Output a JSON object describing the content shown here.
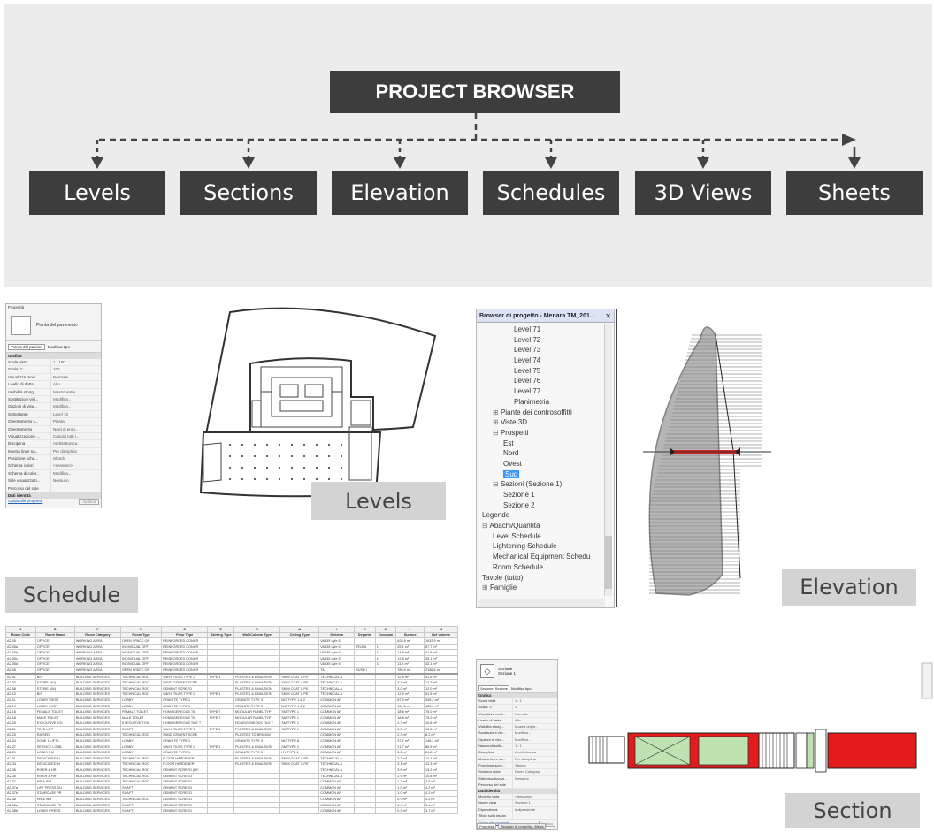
{
  "diagram": {
    "title": "PROJECT BROWSER",
    "categories": [
      "Levels",
      "Sections",
      "Elevation",
      "Schedules",
      "3D Views",
      "Sheets"
    ]
  },
  "labels": {
    "levels": "Levels",
    "elevation": "Elevation",
    "schedule": "Schedule",
    "section": "Section"
  },
  "properties_panel": {
    "header": "Proprietà",
    "type_name": "Pianta del pavimento",
    "type_selector": "Pianta del pavime",
    "edit_type": "Modifica tipo",
    "group": "Grafica",
    "rows": [
      {
        "k": "Scala vista",
        "v": "1 : 100"
      },
      {
        "k": "Scala: 1:",
        "v": "100"
      },
      {
        "k": "Visualizza modi...",
        "v": "Normale"
      },
      {
        "k": "Livello di detta...",
        "v": "Alto"
      },
      {
        "k": "Visibilità strutg...",
        "v": "Mostra entra..."
      },
      {
        "k": "Sostituzioni visi...",
        "v": "Modifica..."
      },
      {
        "k": "Opzioni di visu...",
        "v": "Modifica..."
      },
      {
        "k": "Sottostante",
        "v": "Level 10"
      },
      {
        "k": "Orientamento s...",
        "v": "Pianta"
      },
      {
        "k": "Orientamento",
        "v": "Nord di prog..."
      },
      {
        "k": "Visualizzazione ...",
        "v": "Calcola tutti i..."
      },
      {
        "k": "Disciplina",
        "v": "Architettonica"
      },
      {
        "k": "Mostra linee na...",
        "v": "Per disciplina"
      },
      {
        "k": "Posizione sche...",
        "v": "Sfondo"
      },
      {
        "k": "Schema colori",
        "v": "<nessuno>"
      },
      {
        "k": "Schema di color...",
        "v": "Modifica..."
      },
      {
        "k": "Stile visualizzazi...",
        "v": "Nessuno"
      },
      {
        "k": "Percorso del sole",
        "v": ""
      }
    ],
    "group2": "Dati identità",
    "help_link": "Guida alle proprietà",
    "apply": "Applica"
  },
  "browser_panel": {
    "title": "Browser di progetto - Menara TM_201...",
    "close": "✕",
    "items": [
      {
        "label": "Level 71",
        "indent": 3
      },
      {
        "label": "Level 72",
        "indent": 3
      },
      {
        "label": "Level 73",
        "indent": 3
      },
      {
        "label": "Level 74",
        "indent": 3
      },
      {
        "label": "Level 75",
        "indent": 3
      },
      {
        "label": "Level 76",
        "indent": 3
      },
      {
        "label": "Level 77",
        "indent": 3
      },
      {
        "label": "Planimetria",
        "indent": 3
      },
      {
        "label": "Piante dei controsoffitti",
        "indent": 1,
        "toggle": "+"
      },
      {
        "label": "Viste 3D",
        "indent": 1,
        "toggle": "+"
      },
      {
        "label": "Prospetti",
        "indent": 1,
        "toggle": "−"
      },
      {
        "label": "Est",
        "indent": 2
      },
      {
        "label": "Nord",
        "indent": 2
      },
      {
        "label": "Ovest",
        "indent": 2
      },
      {
        "label": "Sud",
        "indent": 2,
        "selected": true
      },
      {
        "label": "Sezioni (Sezione 1)",
        "indent": 1,
        "toggle": "−"
      },
      {
        "label": "Sezione 1",
        "indent": 2
      },
      {
        "label": "Sezione 2",
        "indent": 2
      },
      {
        "label": "Legende",
        "indent": 0
      },
      {
        "label": "Abachi/Quantità",
        "indent": 0,
        "toggle": "−"
      },
      {
        "label": "Level Schedule",
        "indent": 1
      },
      {
        "label": "Lightening Schedule",
        "indent": 1
      },
      {
        "label": "Mechanical Equipment Schedu",
        "indent": 1
      },
      {
        "label": "Room Schedule",
        "indent": 1
      },
      {
        "label": "Tavole (tutto)",
        "indent": 0
      },
      {
        "label": "Famiglie",
        "indent": 0,
        "toggle": "+"
      }
    ]
  },
  "schedule": {
    "letters": [
      "A",
      "B",
      "C",
      "D",
      "E",
      "F",
      "G",
      "H",
      "I",
      "J",
      "K",
      "L",
      "M"
    ],
    "headers": [
      "Room Code",
      "Room Name",
      "Room Category",
      "Room Type",
      "Floor Type",
      "Skirting Type",
      "Wall/Column Type",
      "Ceiling Type",
      "Division",
      "Departm",
      "Occupan",
      "Surface",
      "Net Volume"
    ],
    "rows": [
      [
        "A2.05",
        "OFFICE",
        "WORKING AREA",
        "OPEN SPACE OF",
        "REINFORCED CONCR",
        "",
        "",
        "",
        "VA535 Lyfe 5",
        "",
        "",
        "628.8 m²",
        "1933.5 m³"
      ],
      [
        "A2.05a",
        "OFFICE",
        "WORKING AREA",
        "INDIVIDUAL OFFI",
        "REINFORCED CONCR",
        "",
        "",
        "",
        "VA535 Lyfe 5",
        "TELEA",
        "1",
        "25.1 m²",
        "87.7 m³"
      ],
      [
        "A2.05b",
        "OFFICE",
        "WORKING AREA",
        "INDIVIDUAL OFFI",
        "REINFORCED CONCR",
        "",
        "",
        "",
        "VA535 Lyfe 5",
        "",
        "1",
        "14.8 m²",
        "41.8 m³"
      ],
      [
        "A2.05c",
        "OFFICE",
        "WORKING AREA",
        "INDIVIDUAL OFFI",
        "REINFORCED CONCR",
        "",
        "",
        "",
        "VA535 Lyfe 5",
        "",
        "1",
        "12.6 m²",
        "35.1 m³"
      ],
      [
        "A2.05d",
        "OFFICE",
        "WORKING AREA",
        "INDIVIDUAL OFFI",
        "REINFORCED CONCR",
        "",
        "",
        "",
        "VA535 Lyfe 5",
        "",
        "1",
        "11.2 m²",
        "32.1 m³"
      ],
      [
        "A2.06",
        "OFFICE",
        "WORKING AREA",
        "OPEN SPACE OF",
        "REINFORCED CONCR",
        "",
        "",
        "",
        "TA",
        "SUSD I",
        "",
        "786.6 m²",
        "2186.6 m³"
      ],
      [
        "A2.01",
        "BIS",
        "BUILDING SERVICES",
        "TECHNICAL ROO",
        "VINYL TILES TYPE 2",
        "TYPE 1",
        "PLASTER & EMULSION",
        "SKIM COAT & PE",
        "TECHNICAL A",
        "",
        "",
        "12.8 m²",
        "51.6 m³"
      ],
      [
        "A2.03",
        "STORE (AV)",
        "BUILDING SERVICES",
        "TECHNICAL ROO",
        "SAND CEMENT SCRE",
        "",
        "PLASTER & EMULSION",
        "SKIM COAT & PE",
        "TECHNICAL A",
        "",
        "",
        "3.1 m²",
        "12.3 m³"
      ],
      [
        "A2.08",
        "STORE (AV)",
        "BUILDING SERVICES",
        "TECHNICAL ROO",
        "CEMENT SCREED",
        "",
        "PLASTER & EMULSION",
        "SKIM COAT & PE",
        "TECHNICAL A",
        "",
        "",
        "3.0 m²",
        "12.0 m³"
      ],
      [
        "A2.10",
        "BIS",
        "BUILDING SERVICES",
        "TECHNICAL ROO",
        "VINYL TILES TYPE 2",
        "TYPE 1",
        "PLASTER & EMULSION",
        "SKIM COAT & PE",
        "TECHNICAL A",
        "",
        "",
        "12.9 m²",
        "51.5 m³"
      ],
      [
        "A2.11",
        "LOBBY WEST",
        "BUILDING SERVICES",
        "LOBBY",
        "GRANITE TYPE 1",
        "",
        "GRANITE TYPE 3",
        "MC TYPE 1 & 2",
        "COMMON AR",
        "",
        "",
        "87.3 m²",
        "349.2 m³"
      ],
      [
        "A2.14",
        "LOBBY EAST",
        "BUILDING SERVICES",
        "LOBBY",
        "GRANITE TYPE 1",
        "",
        "GRANITE TYPE 3",
        "MC TYPE 1 & 2",
        "COMMON AR",
        "",
        "",
        "161.5 m²",
        "485.9 m³"
      ],
      [
        "A2.16",
        "FEMALE TOILET",
        "BUILDING SERVICES",
        "FEMALE TOILET",
        "HOMOGENEOUS TIL",
        "TYPE 7",
        "MODULAR PANEL TYP",
        "SM TYPE 1",
        "COMMON AR",
        "",
        "",
        "18.8 m²",
        "75.0 m³"
      ],
      [
        "A2.18",
        "MALE TOILET",
        "BUILDING SERVICES",
        "MALE TOILET",
        "HOMOGENEOUS TIL",
        "TYPE 7",
        "MODULAR PANEL TYP",
        "SM TYPE 1",
        "COMMON AR",
        "",
        "",
        "18.8 m²",
        "75.0 m³"
      ],
      [
        "A2.20",
        "EXECUTIVE TOI",
        "BUILDING SERVICES",
        "EXECUTIVE TOIL",
        "HOMOGENEOUS TILE T",
        "",
        "HOMOGENEOUS TILE T",
        "SM TYPE 1",
        "COMMON AR",
        "",
        "",
        "2.7 m²",
        "10.8 m³"
      ],
      [
        "A2.21",
        "TELE LIFT",
        "BUILDING SERVICES",
        "SHAFT",
        "VINYL TILES TYPE 1",
        "TYPE 1",
        "PLASTER & EMULSION",
        "SM TYPE 1",
        "COMMON AR",
        "",
        "",
        "3.3 m²",
        "13.8 m³"
      ],
      [
        "A2.23",
        "RAISED",
        "BUILDING SERVICES",
        "TECHNICAL ROO",
        "SAND CEMENT SCRE",
        "",
        "PLASTER TO BRICKW",
        "",
        "COMMON AR",
        "",
        "",
        "2.3 m²",
        "8.2 m³"
      ],
      [
        "A2.24",
        "ZONE 1 LIFT L",
        "BUILDING SERVICES",
        "LOBBY",
        "GRANITE TYPE 1",
        "",
        "GRANITE TYPE 3",
        "MC TYPE 8",
        "COMMON AR",
        "",
        "",
        "37.1 m²",
        "148.4 m³"
      ],
      [
        "A2.27",
        "SERVICE LOBB",
        "BUILDING SERVICES",
        "LOBBY",
        "VINYL TILES TYPE 2",
        "TYPE 1",
        "PLASTER & EMULSION",
        "SM TYPE 2",
        "COMMON AR",
        "",
        "",
        "21.7 m²",
        "86.9 m³"
      ],
      [
        "A2.29",
        "LOBBY FM",
        "BUILDING SERVICES",
        "LOBBY",
        "GRANITE TYPE 1",
        "",
        "GRANITE TYPE 3",
        "HY TYPE 1",
        "COMMON AR",
        "",
        "",
        "6.2 m²",
        "24.8 m³"
      ],
      [
        "A2.31",
        "DEDICATED AI",
        "BUILDING SERVICES",
        "TECHNICAL ROO",
        "FLOOR HARDENER",
        "",
        "PLASTER & EMULSION",
        "SKIM COAT & PE",
        "TECHNICAL A",
        "",
        "",
        "3.1 m²",
        "12.3 m³"
      ],
      [
        "A2.34",
        "DEDICATED AI",
        "BUILDING SERVICES",
        "TECHNICAL ROO",
        "FLOOR HARDENER",
        "",
        "PLASTER & EMULSION",
        "SKIM COAT & PE",
        "TECHNICAL A",
        "",
        "",
        "3.1 m²",
        "12.3 m³"
      ],
      [
        "A2.35",
        "RISER & HR",
        "BUILDING SERVICES",
        "TECHNICAL ROO",
        "CEMENT SCREED (HC",
        "",
        "",
        "",
        "TECHNICAL A",
        "",
        "",
        "3.5 m²",
        "13.2 m³"
      ],
      [
        "A2.36",
        "RISER & HR",
        "BUILDING SERVICES",
        "TECHNICAL ROO",
        "CEMENT SCREED",
        "",
        "",
        "",
        "TECHNICAL A",
        "",
        "",
        "2.9 m²",
        "10.8 m³"
      ],
      [
        "A2.37",
        "HR & WR",
        "BUILDING SERVICES",
        "TECHNICAL ROO",
        "CEMENT SCREED",
        "",
        "",
        "",
        "COMMON AR",
        "",
        "",
        "1.2 m²",
        "4.8 m³"
      ],
      [
        "A2.37a",
        "LIFT PRESS DU",
        "BUILDING SERVICES",
        "SHAFT",
        "CEMENT SCREED",
        "",
        "",
        "",
        "COMMON AR",
        "",
        "",
        "1.0 m²",
        "4.2 m³"
      ],
      [
        "A2.37b",
        "STAIRCASE PR",
        "BUILDING SERVICES",
        "SHAFT",
        "CEMENT SCREED",
        "",
        "",
        "",
        "COMMON AR",
        "",
        "",
        "1.0 m²",
        "4.2 m³"
      ],
      [
        "A2.38",
        "HR & WR",
        "BUILDING SERVICES",
        "TECHNICAL ROO",
        "CEMENT SCREED",
        "",
        "",
        "",
        "COMMON AR",
        "",
        "",
        "0.9 m²",
        "3.5 m³"
      ],
      [
        "A2.38a",
        "STAIRCASE PR",
        "BUILDING SERVICES",
        "SHAFT",
        "CEMENT SCREED",
        "",
        "",
        "",
        "COMMON AR",
        "",
        "",
        "0.9 m²",
        "3.4 m³"
      ],
      [
        "A2.38b",
        "LOBBY PRESS",
        "BUILDING SERVICES",
        "SHAFT",
        "CEMENT SCREED",
        "",
        "",
        "",
        "COMMON AR",
        "",
        "",
        "0.9 m²",
        "3.7 m³"
      ]
    ]
  },
  "section_props": {
    "type_name": "Sezione",
    "type_sub": "Sezione 1",
    "type_selector": "Sezione: Sezione",
    "edit_type": "Modifica tipo",
    "group": "Grafica",
    "rows": [
      {
        "k": "Scala vista",
        "v": "1 : 1"
      },
      {
        "k": "Scala: 1:",
        "v": "1"
      },
      {
        "k": "Visualizza mod...",
        "v": "Normale"
      },
      {
        "k": "Livello di detta...",
        "v": "Alto"
      },
      {
        "k": "Visibilità strutg...",
        "v": "Mostra origin..."
      },
      {
        "k": "Sostituzioni visi...",
        "v": "Modifica..."
      },
      {
        "k": "Opzioni di visu...",
        "v": "Modifica..."
      },
      {
        "k": "Nascondi sulle...",
        "v": "1 : 1"
      },
      {
        "k": "Disciplina",
        "v": "Architettonica"
      },
      {
        "k": "Mostra linee na...",
        "v": "Per disciplina"
      },
      {
        "k": "Posizione sche...",
        "v": "Sfondo"
      },
      {
        "k": "Schema colori",
        "v": "Room Category"
      },
      {
        "k": "Stile visualizzazi...",
        "v": "Nessuno"
      },
      {
        "k": "Percorso del sole",
        "v": ""
      }
    ],
    "group2": "Dati identità",
    "rows2": [
      {
        "k": "Modello vista",
        "v": "<Nessuno>"
      },
      {
        "k": "Nome vista",
        "v": "Sezione 1"
      },
      {
        "k": "Dipendenza",
        "v": "Indipendente"
      },
      {
        "k": "Titolo sulla tavola",
        "v": ""
      }
    ],
    "help_link": "Guida alle proprietà",
    "apply": "Applica",
    "tabs": [
      "Proprietà",
      "Browser di progetto - Mena"
    ]
  },
  "colors": {
    "dark_box": "#3d3d3d",
    "section_red": "#e21b1b",
    "section_green": "#bfe3b0",
    "selected": "#3399ff"
  }
}
